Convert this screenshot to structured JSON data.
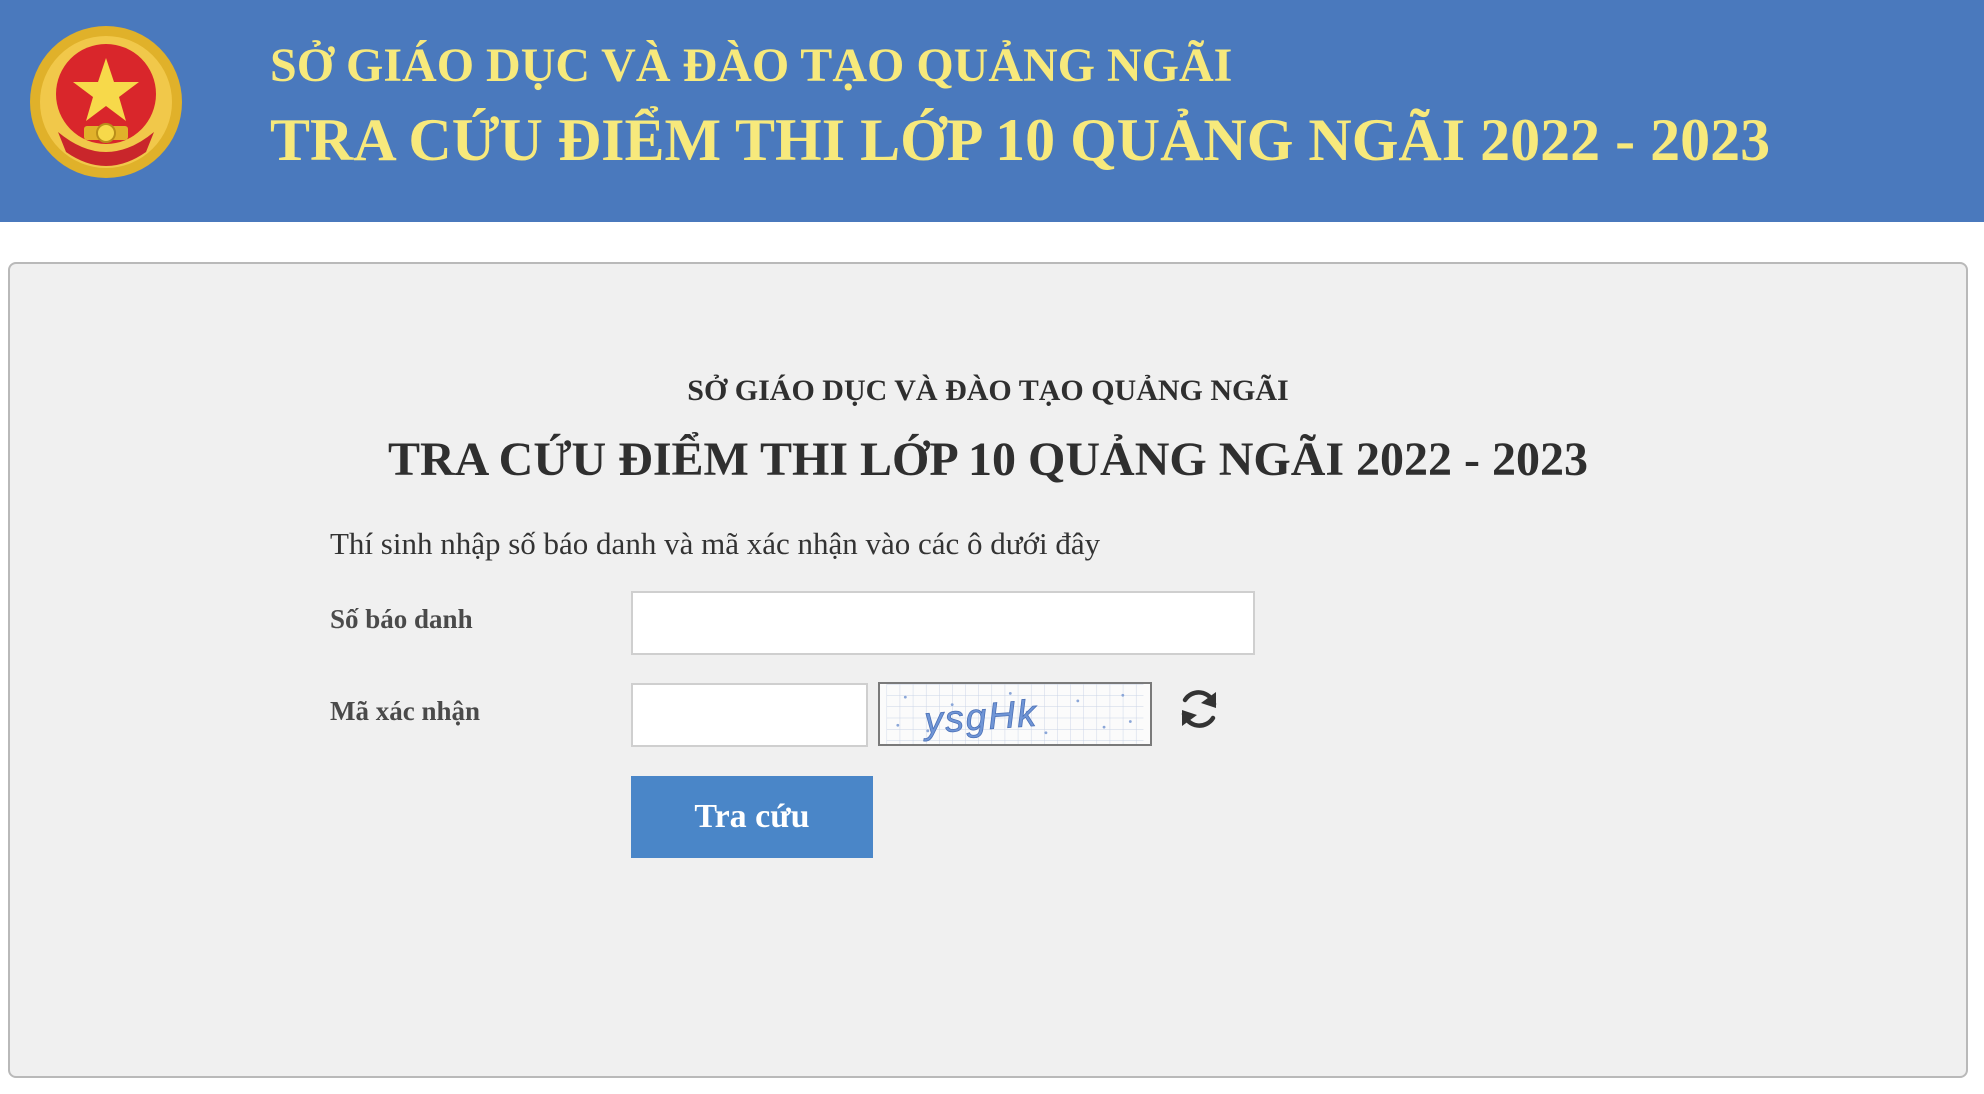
{
  "header": {
    "line1": "SỞ GIÁO DỤC VÀ ĐÀO TẠO QUẢNG NGÃI",
    "line2": "TRA CỨU ĐIỂM THI LỚP 10 QUẢNG NGÃI 2022 - 2023",
    "emblem_icon": "national-emblem-icon"
  },
  "panel": {
    "title1": "SỞ GIÁO DỤC VÀ ĐÀO TẠO QUẢNG NGÃI",
    "title2": "TRA CỨU ĐIỂM THI LỚP 10 QUẢNG NGÃI 2022 - 2023",
    "instruction": "Thí sinh nhập số báo danh và mã xác nhận vào các ô dưới đây"
  },
  "form": {
    "sbd_label": "Số báo danh",
    "sbd_value": "",
    "captcha_label": "Mã xác nhận",
    "captcha_value": "",
    "captcha_text": "ysgHk",
    "refresh_icon": "refresh-icon",
    "submit_label": "Tra cứu"
  },
  "colors": {
    "header_bg": "#4a79bd",
    "header_text": "#f7e97c",
    "panel_bg": "#f0f0f0",
    "button_bg": "#4a86c8"
  }
}
